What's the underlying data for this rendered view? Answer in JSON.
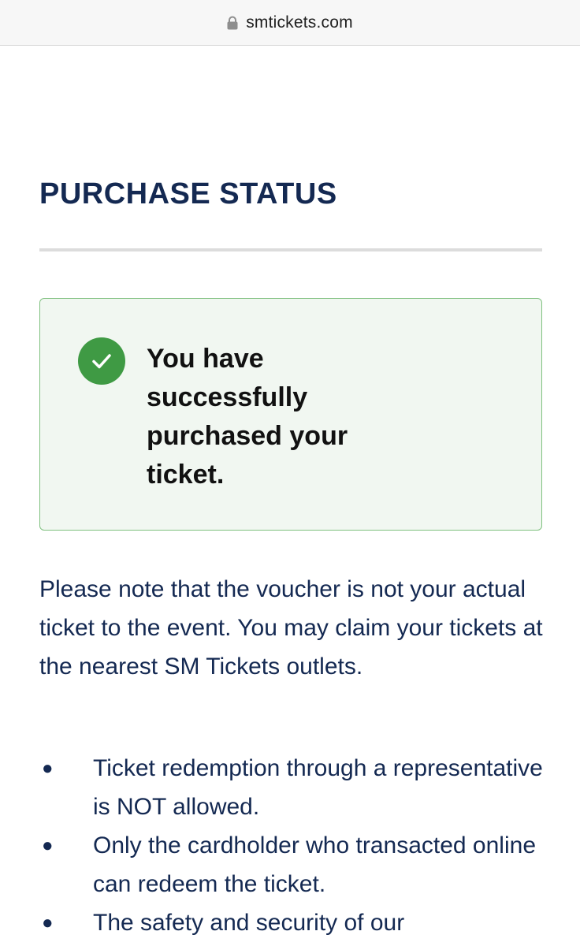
{
  "browser": {
    "url": "smtickets.com"
  },
  "page": {
    "title": "PURCHASE STATUS",
    "success_message": "You have successfully purchased your ticket.",
    "note": "Please note that the voucher is not your actual ticket to the event. You may claim your tickets at the nearest SM Tickets outlets.",
    "rules": [
      "Ticket redemption through a representative is NOT allowed.",
      "Only the cardholder who transacted online can redeem the ticket.",
      "The safety and security of our"
    ]
  },
  "colors": {
    "title": "#142952",
    "success_bg": "#f1f7f1",
    "success_border": "#7fc07f",
    "check": "#3f9a44"
  },
  "icons": {
    "lock": "lock-icon",
    "check": "checkmark-icon",
    "bullet": "bullet-icon"
  }
}
